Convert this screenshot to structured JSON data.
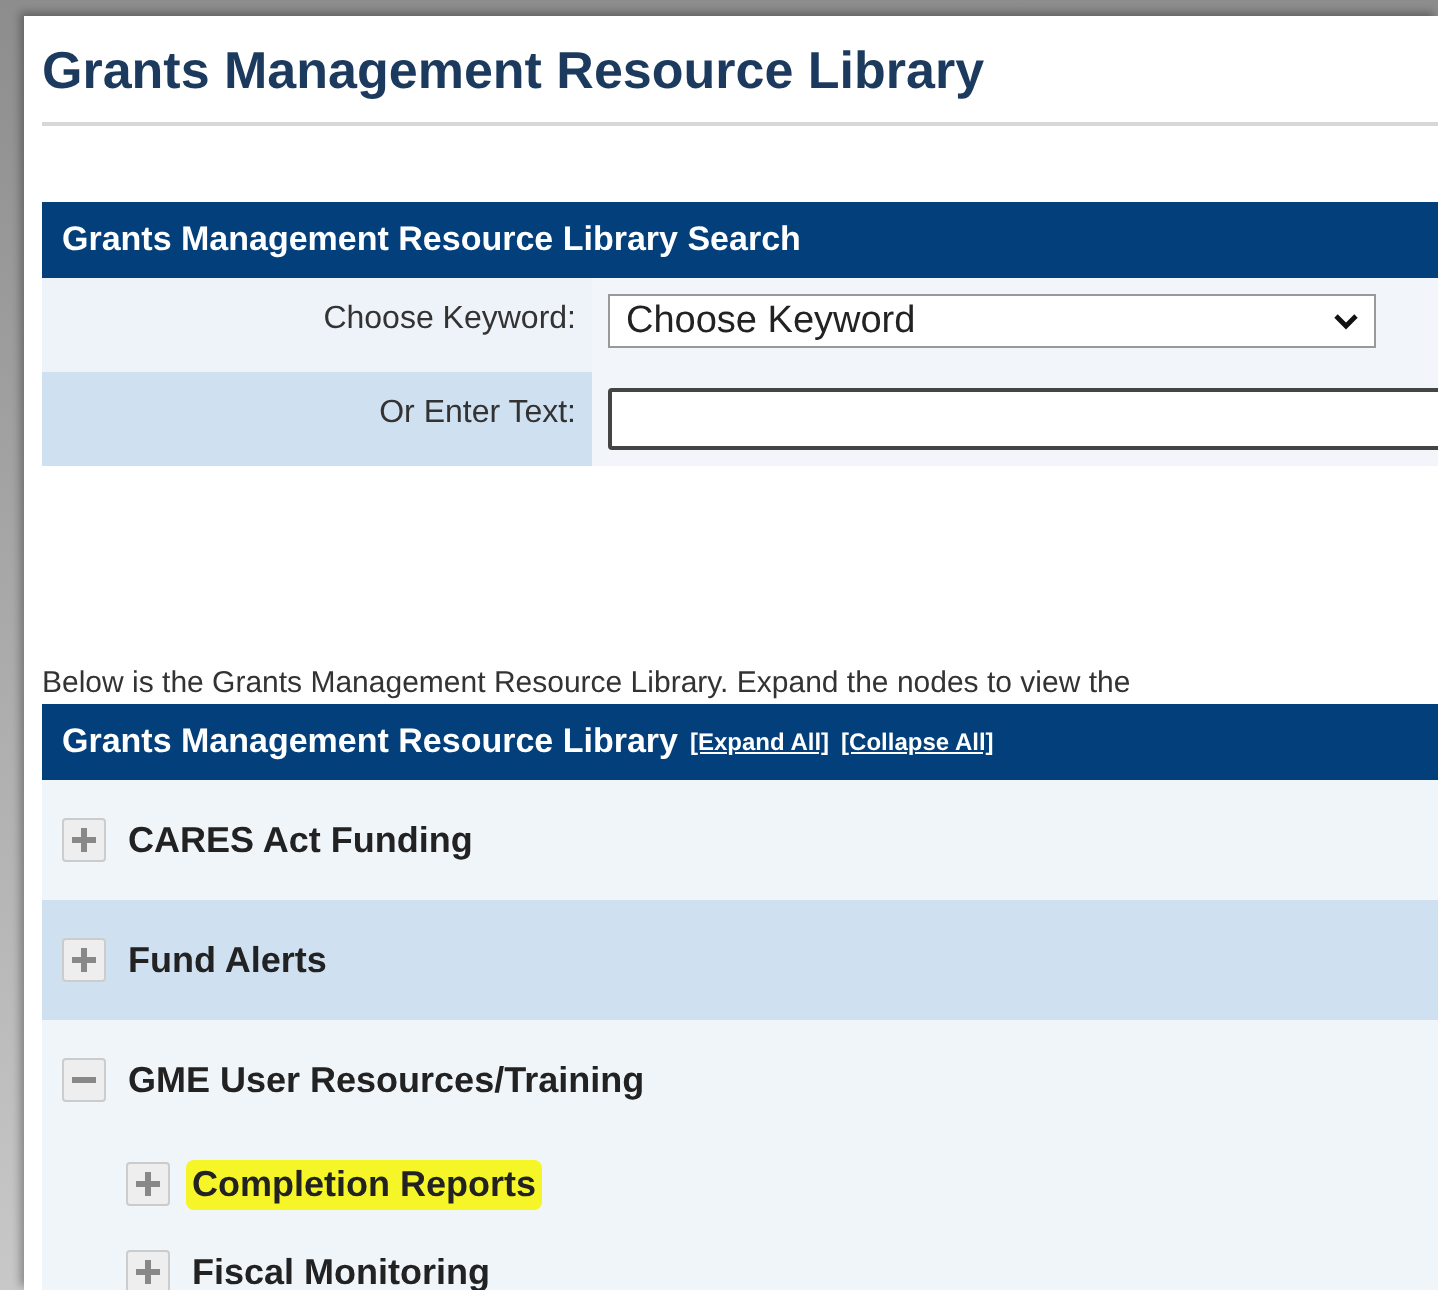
{
  "page_title": "Grants Management Resource Library",
  "search": {
    "title": "Grants Management Resource Library Search",
    "rows": [
      {
        "kind": "select",
        "label": "Choose Keyword:",
        "value": "Choose Keyword"
      },
      {
        "kind": "text",
        "label": "Or Enter Text:",
        "value": ""
      }
    ]
  },
  "intro": "Below is the Grants Management Resource Library. Expand the nodes to view the",
  "library": {
    "title": "Grants Management Resource Library",
    "links": [
      "[Expand All]",
      "[Collapse All]"
    ],
    "nodes": [
      {
        "label": "CARES Act Funding",
        "expanded": false,
        "highlighted": false
      },
      {
        "label": "Fund Alerts",
        "expanded": false,
        "highlighted": false
      },
      {
        "label": "GME User Resources/Training",
        "expanded": true,
        "highlighted": false,
        "children": [
          {
            "label": "Completion Reports",
            "expanded": false,
            "highlighted": true
          },
          {
            "label": "Fiscal Monitoring",
            "expanded": false,
            "highlighted": false
          }
        ]
      }
    ]
  }
}
